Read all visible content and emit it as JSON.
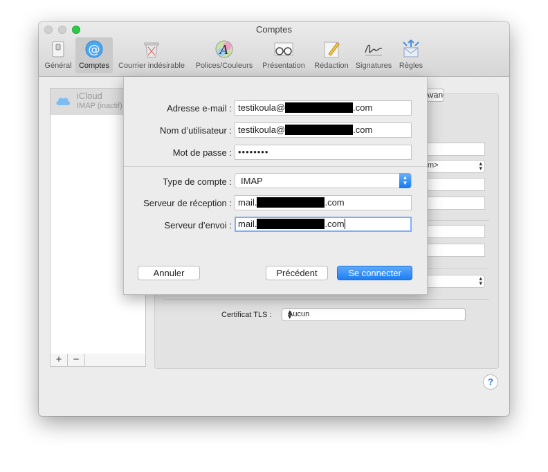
{
  "window": {
    "title": "Comptes"
  },
  "toolbar": {
    "items": [
      {
        "label": "Général",
        "icon": "general-switch-icon"
      },
      {
        "label": "Comptes",
        "icon": "at-sign-icon",
        "selected": true
      },
      {
        "label": "Courrier indésirable",
        "icon": "junk-trash-icon"
      },
      {
        "label": "Polices/Couleurs",
        "icon": "fonts-colors-icon"
      },
      {
        "label": "Présentation",
        "icon": "glasses-icon"
      },
      {
        "label": "Rédaction",
        "icon": "pencil-icon"
      },
      {
        "label": "Signatures",
        "icon": "signature-icon"
      },
      {
        "label": "Règles",
        "icon": "rules-envelope-icon"
      }
    ]
  },
  "accounts": {
    "items": [
      {
        "name": "iCloud",
        "subtitle": "IMAP (inactif)",
        "icon": "icloud-icon"
      }
    ],
    "add_label": "+",
    "remove_label": "−"
  },
  "detail": {
    "advanced_tab": "Avancé",
    "ghost_select": "m>",
    "tls_label": "Certificat TLS :",
    "tls_value": "Aucun",
    "help": "?"
  },
  "sheet": {
    "email": {
      "label": "Adresse e-mail :",
      "prefix": "testikoula@",
      "suffix": ".com"
    },
    "username": {
      "label": "Nom d’utilisateur :",
      "prefix": "testikoula@",
      "suffix": ".com"
    },
    "password": {
      "label": "Mot de passe :",
      "value": "••••••••"
    },
    "account_type": {
      "label": "Type de compte :",
      "value": "IMAP"
    },
    "incoming": {
      "label": "Serveur de réception :",
      "prefix": "mail.",
      "suffix": ".com"
    },
    "outgoing": {
      "label": "Serveur d’envoi :",
      "prefix": "mail.",
      "suffix": ".com"
    },
    "buttons": {
      "cancel": "Annuler",
      "previous": "Précédent",
      "connect": "Se connecter"
    }
  },
  "colors": {
    "accent": "#1c7ef5",
    "focus_ring": "#7fadf6",
    "window_bg": "#ececec"
  }
}
